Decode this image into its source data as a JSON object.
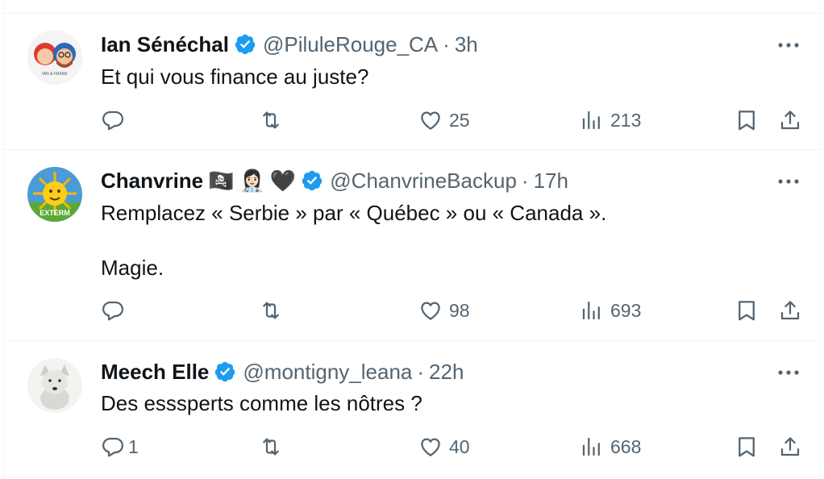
{
  "tweets": [
    {
      "name": "Ian Sénéchal",
      "handle": "@PiluleRouge_CA",
      "separator": "·",
      "time": "3h",
      "text": "Et qui vous finance au juste?",
      "avatar_caption": "IAN & FRANK",
      "replies": "",
      "likes": "25",
      "views": "213"
    },
    {
      "name": "Chanvrine",
      "emojis": [
        "🏴‍☠️",
        "👩🏻‍⚕️",
        "🖤"
      ],
      "handle": "@ChanvrineBackup",
      "separator": "·",
      "time": "17h",
      "text": "Remplacez « Serbie » par « Québec » ou « Canada ».\n\nMagie.",
      "avatar_caption": "EXTERM",
      "replies": "",
      "likes": "98",
      "views": "693"
    },
    {
      "name": "Meech Elle",
      "handle": "@montigny_leana",
      "separator": "·",
      "time": "22h",
      "text": "Des esssperts comme les nôtres ?",
      "replies": "1",
      "likes": "40",
      "views": "668"
    }
  ],
  "colors": {
    "verified": "#1d9bf0",
    "text": "#0f1419",
    "muted": "#536471",
    "border": "#eff3f4"
  }
}
